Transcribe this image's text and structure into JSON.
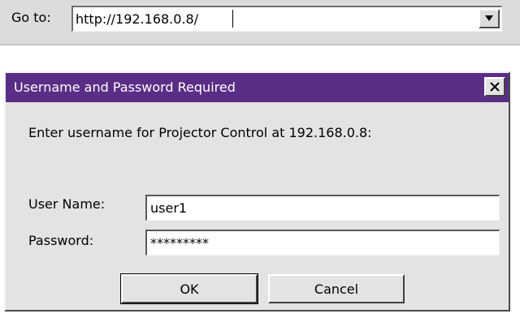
{
  "address_bar": {
    "label": "Go to:",
    "url": "http://192.168.0.8/",
    "dropdown_icon": "chevron-down-icon"
  },
  "dialog": {
    "title": "Username and Password Required",
    "close_icon": "close-icon",
    "title_bar_color": "#5a2d86",
    "prompt": "Enter username for Projector Control at 192.168.0.8:",
    "username_label": "User Name:",
    "username_value": "user1",
    "password_label": "Password:",
    "password_value": "*********",
    "ok_label": "OK",
    "cancel_label": "Cancel"
  }
}
